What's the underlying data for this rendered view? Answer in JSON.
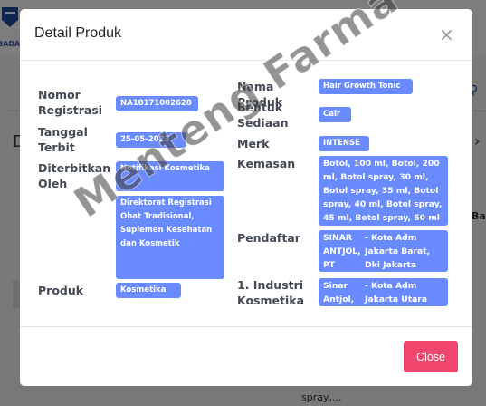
{
  "background": {
    "logo_text": "BADA",
    "letter": "D",
    "side_text": "Ba",
    "bottom_text": "spray,..."
  },
  "modal": {
    "title": "Detail Produk",
    "close_icon": "×",
    "close_button": "Close"
  },
  "left_fields": {
    "nomor_registrasi": {
      "label": "Nomor Registrasi",
      "value": "NA18171002628"
    },
    "tanggal_terbit": {
      "label": "Tanggal Terbit",
      "value": "25-05-2023"
    },
    "diterbitkan_oleh": {
      "label": "Diterbitkan Oleh",
      "value_1": "Notifikasi Kosmetika",
      "value_2": "Direktorat Registrasi Obat Tradisional, Suplemen Kesehatan dan Kosmetik"
    },
    "produk": {
      "label": "Produk",
      "value": "Kosmetika"
    }
  },
  "right_fields": {
    "nama_produk": {
      "label": "Nama Produk",
      "value": "Hair Growth Tonic"
    },
    "bentuk_sediaan": {
      "label": "Bentuk Sediaan",
      "value": "Cair"
    },
    "merk": {
      "label": "Merk",
      "value": "INTENSE"
    },
    "kemasan": {
      "label": "Kemasan",
      "value": "Botol, 100 ml, Botol, 200 ml, Botol spray, 30 ml, Botol spray, 35 ml, Botol spray, 40 ml, Botol spray, 45 ml, Botol spray, 50 ml"
    },
    "pendaftar": {
      "label": "Pendaftar",
      "name": "SINAR ANTJOL, PT",
      "address": "- Kota Adm Jakarta Barat, Dki Jakarta"
    },
    "industri": {
      "label": "1. Industri Kosmetika",
      "name": "Sinar Antjol, PT",
      "address": "- Kota Adm Jakarta Utara"
    }
  },
  "watermark": "Menteng Farma",
  "colors": {
    "pill": "#6a8bff",
    "close_button": "#f0466e",
    "label": "#434a54"
  }
}
